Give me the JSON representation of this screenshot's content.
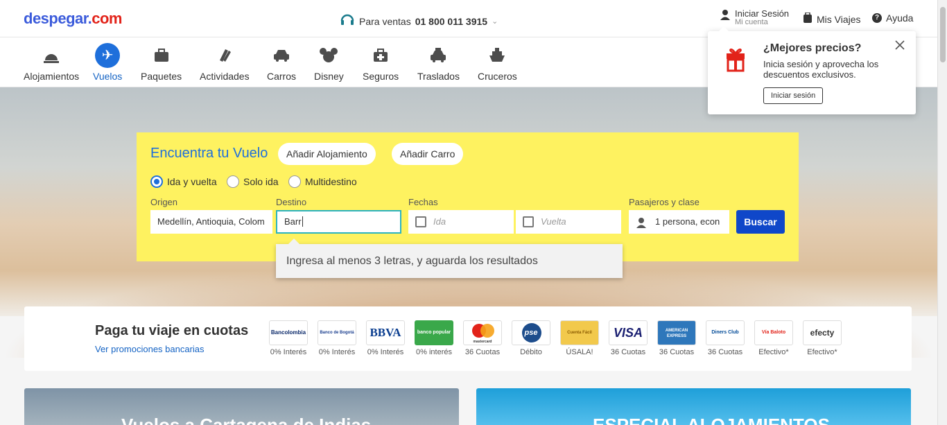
{
  "header": {
    "logo_text": "despegar",
    "logo_com": "com",
    "sales_label": "Para ventas",
    "sales_phone": "01 800 011 3915",
    "account_title": "Iniciar Sesión",
    "account_sub": "Mi cuenta",
    "trips": "Mis Viajes",
    "help": "Ayuda"
  },
  "nav": {
    "items": [
      {
        "label": "Alojamientos",
        "icon": "bell-icon"
      },
      {
        "label": "Vuelos",
        "icon": "plane-icon",
        "active": true
      },
      {
        "label": "Paquetes",
        "icon": "suitcase-icon"
      },
      {
        "label": "Actividades",
        "icon": "tickets-icon"
      },
      {
        "label": "Carros",
        "icon": "car-icon"
      },
      {
        "label": "Disney",
        "icon": "mickey-icon"
      },
      {
        "label": "Seguros",
        "icon": "medical-case-icon"
      },
      {
        "label": "Traslados",
        "icon": "taxi-icon"
      },
      {
        "label": "Cruceros",
        "icon": "ship-icon"
      }
    ]
  },
  "search": {
    "title": "Encuentra tu Vuelo",
    "add_lodging": "Añadir Alojamiento",
    "add_car": "Añadir Carro",
    "trip_types": [
      "Ida y vuelta",
      "Solo ida",
      "Multidestino"
    ],
    "origin_label": "Origen",
    "origin_value": "Medellín, Antioquia, Colom",
    "dest_label": "Destino",
    "dest_value": "Barr",
    "dates_label": "Fechas",
    "depart_placeholder": "Ida",
    "return_placeholder": "Vuelta",
    "pax_label": "Pasajeros y clase",
    "pax_value": "1 persona, econ",
    "search_button": "Buscar",
    "hint": "Ingresa al menos 3 letras, y aguarda los resultados",
    "accent_color": "#1e6fdb",
    "box_color": "#fef260"
  },
  "popup": {
    "title": "¿Mejores precios?",
    "text": "Inicia sesión y aprovecha los descuentos exclusivos.",
    "button": "Iniciar sesión"
  },
  "installments": {
    "title": "Paga tu viaje en cuotas",
    "link": "Ver promociones bancarias",
    "banks": [
      {
        "name": "Bancolombia",
        "label": "0% Interés"
      },
      {
        "name": "Banco de Bogotá",
        "label": "0% Interés"
      },
      {
        "name": "BBVA",
        "label": "0% Interés"
      },
      {
        "name": "banco popular",
        "label": "0% interés"
      },
      {
        "name": "mastercard",
        "label": "36 Cuotas"
      },
      {
        "name": "pse",
        "label": "Débito"
      },
      {
        "name": "Cuenta Fácil",
        "label": "ÚSALA!"
      },
      {
        "name": "VISA",
        "label": "36 Cuotas"
      },
      {
        "name": "AMERICAN EXPRESS",
        "label": "36 Cuotas"
      },
      {
        "name": "Diners Club",
        "label": "36 Cuotas"
      },
      {
        "name": "Vía Baloto",
        "label": "Efectivo*"
      },
      {
        "name": "efecty",
        "label": "Efectivo*"
      }
    ]
  },
  "promos": {
    "left": "Vuelos a Cartagena de Indias",
    "right": "ESPECIAL ALOJAMIENTOS"
  }
}
